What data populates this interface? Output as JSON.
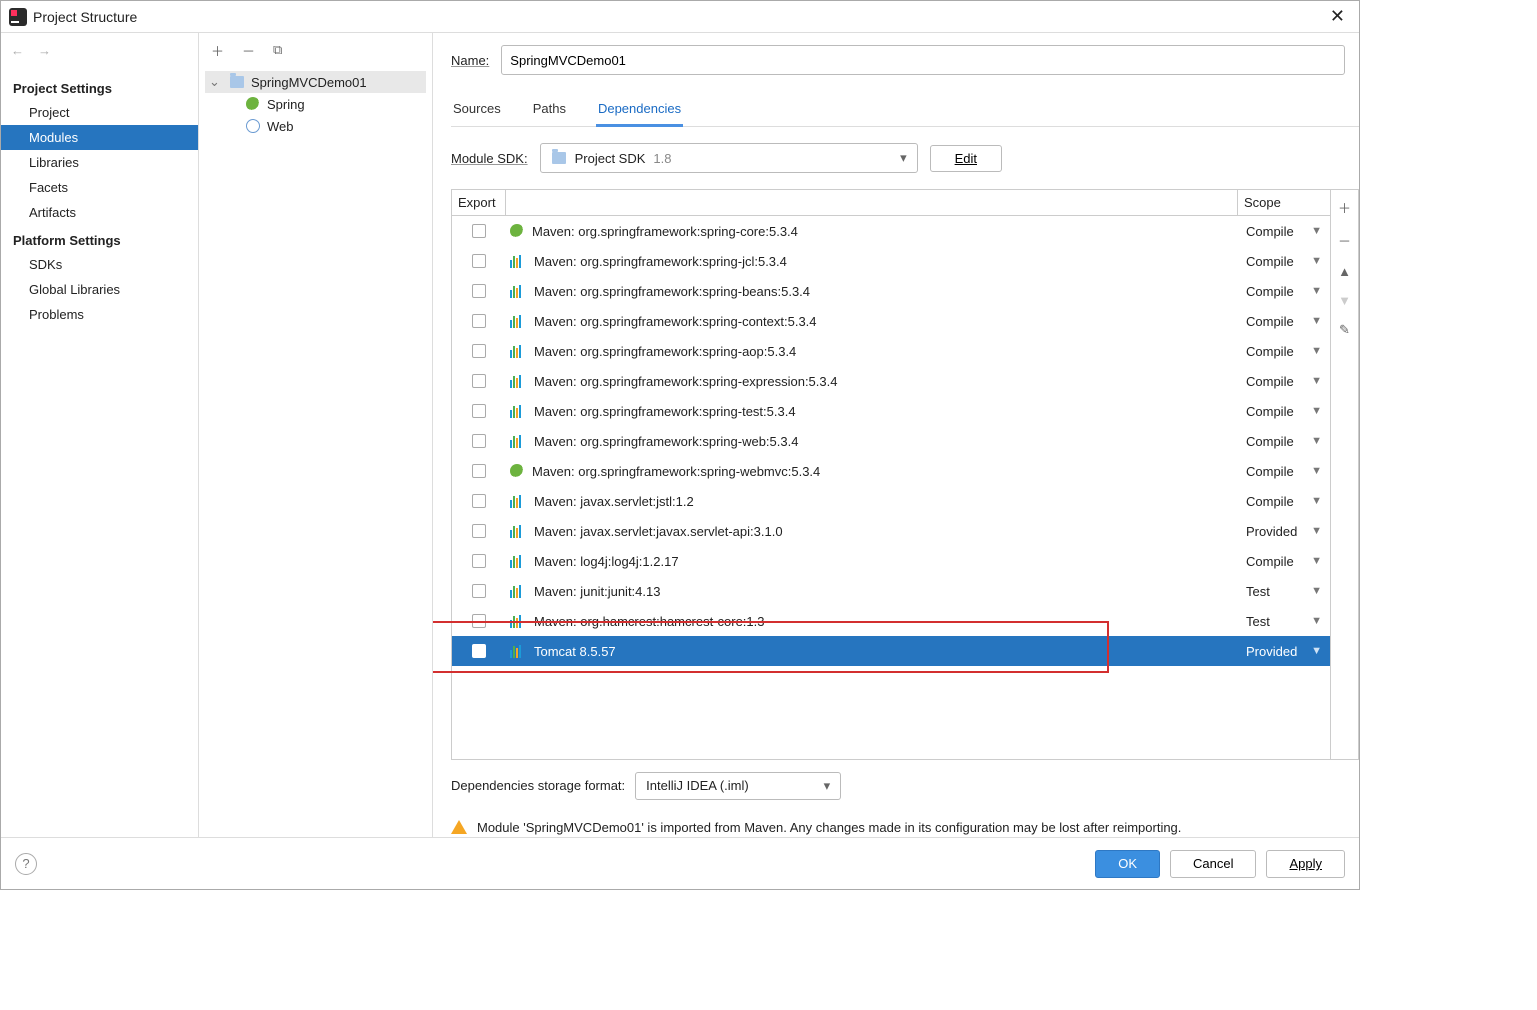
{
  "window": {
    "title": "Project Structure"
  },
  "sidebar": {
    "groups": [
      {
        "title": "Project Settings",
        "items": [
          "Project",
          "Modules",
          "Libraries",
          "Facets",
          "Artifacts"
        ],
        "selected": 1
      },
      {
        "title": "Platform Settings",
        "items": [
          "SDKs",
          "Global Libraries"
        ]
      },
      {
        "title": "",
        "items": [
          "Problems"
        ]
      }
    ]
  },
  "tree": {
    "root": "SpringMVCDemo01",
    "children": [
      "Spring",
      "Web"
    ]
  },
  "form": {
    "name_label": "Name:",
    "name_value": "SpringMVCDemo01",
    "tabs": [
      "Sources",
      "Paths",
      "Dependencies"
    ],
    "active_tab": 2,
    "sdk_label": "Module SDK:",
    "sdk_value": "Project SDK",
    "sdk_version": "1.8",
    "edit_label": "Edit"
  },
  "deps": {
    "headers": [
      "Export",
      "",
      "Scope"
    ],
    "rows": [
      {
        "name": "Maven: org.springframework:spring-core:5.3.4",
        "scope": "Compile",
        "icon": "leaf"
      },
      {
        "name": "Maven: org.springframework:spring-jcl:5.3.4",
        "scope": "Compile",
        "icon": "lib"
      },
      {
        "name": "Maven: org.springframework:spring-beans:5.3.4",
        "scope": "Compile",
        "icon": "lib"
      },
      {
        "name": "Maven: org.springframework:spring-context:5.3.4",
        "scope": "Compile",
        "icon": "lib"
      },
      {
        "name": "Maven: org.springframework:spring-aop:5.3.4",
        "scope": "Compile",
        "icon": "lib"
      },
      {
        "name": "Maven: org.springframework:spring-expression:5.3.4",
        "scope": "Compile",
        "icon": "lib"
      },
      {
        "name": "Maven: org.springframework:spring-test:5.3.4",
        "scope": "Compile",
        "icon": "lib"
      },
      {
        "name": "Maven: org.springframework:spring-web:5.3.4",
        "scope": "Compile",
        "icon": "lib"
      },
      {
        "name": "Maven: org.springframework:spring-webmvc:5.3.4",
        "scope": "Compile",
        "icon": "leaf"
      },
      {
        "name": "Maven: javax.servlet:jstl:1.2",
        "scope": "Compile",
        "icon": "lib"
      },
      {
        "name": "Maven: javax.servlet:javax.servlet-api:3.1.0",
        "scope": "Provided",
        "icon": "lib"
      },
      {
        "name": "Maven: log4j:log4j:1.2.17",
        "scope": "Compile",
        "icon": "lib"
      },
      {
        "name": "Maven: junit:junit:4.13",
        "scope": "Test",
        "icon": "lib"
      },
      {
        "name": "Maven: org.hamcrest:hamcrest-core:1.3",
        "scope": "Test",
        "icon": "lib"
      },
      {
        "name": "Tomcat 8.5.57",
        "scope": "Provided",
        "icon": "lib",
        "selected": true
      }
    ]
  },
  "storage": {
    "label": "Dependencies storage format:",
    "value": "IntelliJ IDEA (.iml)"
  },
  "warning": "Module 'SpringMVCDemo01' is imported from Maven. Any changes made in its configuration may be lost after reimporting.",
  "footer": {
    "ok": "OK",
    "cancel": "Cancel",
    "apply": "Apply"
  }
}
